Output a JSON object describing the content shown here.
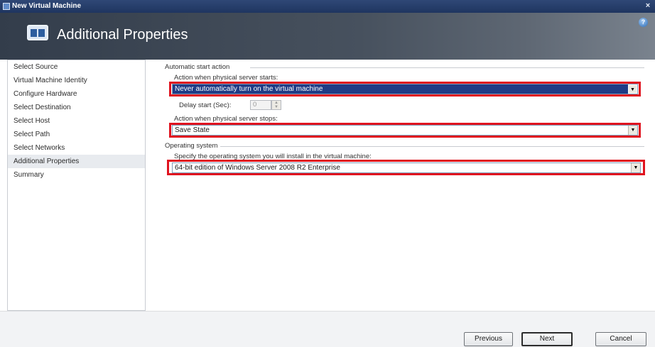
{
  "window": {
    "title": "New Virtual Machine",
    "close_glyph": "×"
  },
  "header": {
    "title": "Additional Properties",
    "help_glyph": "?"
  },
  "sidebar": {
    "items": [
      {
        "label": "Select Source"
      },
      {
        "label": "Virtual Machine Identity"
      },
      {
        "label": "Configure Hardware"
      },
      {
        "label": "Select Destination"
      },
      {
        "label": "Select Host"
      },
      {
        "label": "Select Path"
      },
      {
        "label": "Select Networks"
      },
      {
        "label": "Additional Properties",
        "active": true
      },
      {
        "label": "Summary"
      }
    ]
  },
  "start_group": {
    "title": "Automatic start action",
    "start_label": "Action when physical server starts:",
    "start_value": "Never automatically turn on the virtual machine",
    "delay_label": "Delay start (Sec):",
    "delay_value": "0",
    "stop_label": "Action when physical server stops:",
    "stop_value": "Save State"
  },
  "os_group": {
    "title": "Operating system",
    "os_label": "Specify the operating system you will install in the virtual machine:",
    "os_value": "64-bit edition of Windows Server 2008 R2 Enterprise"
  },
  "footer": {
    "previous_label": "Previous",
    "next_label": "Next",
    "cancel_label": "Cancel"
  },
  "colors": {
    "highlight": "#e0131f",
    "selection": "#1f3c86",
    "titlebar": "#1f3560"
  }
}
